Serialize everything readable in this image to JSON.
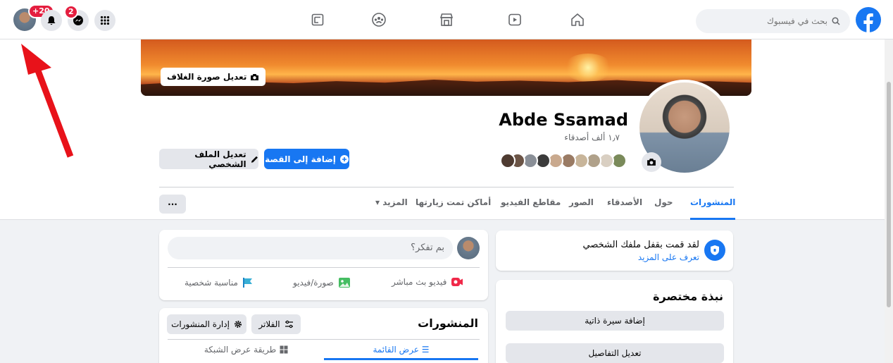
{
  "topbar": {
    "search_placeholder": "بحث في فيسبوك",
    "notifications_badge": "2",
    "profile_badge": "+20"
  },
  "cover": {
    "edit_label": "تعديل صورة الغلاف"
  },
  "profile": {
    "name": "Abde Ssamad",
    "friends": "١٫٧ ألف أصدقاء",
    "add_story_label": "إضافة إلى القصة",
    "edit_profile_label": "تعديل الملف الشخصي",
    "more_button": "···"
  },
  "tabs": [
    {
      "label": "المنشورات"
    },
    {
      "label": "حول"
    },
    {
      "label": "الأصدقاء"
    },
    {
      "label": "الصور"
    },
    {
      "label": "مقاطع الفيديو"
    },
    {
      "label": "أماكن تمت زيارتها"
    },
    {
      "label": "المزيد ▾"
    }
  ],
  "lock_notice": {
    "title": "لقد قمت بقفل ملفك الشخصي",
    "link": "تعرف على المزيد"
  },
  "intro": {
    "title": "نبذة مختصرة",
    "add_bio": "إضافة سيرة ذاتية",
    "edit_details": "تعديل التفاصيل"
  },
  "composer": {
    "placeholder": "بم تفكر؟",
    "live": "فيديو بث مباشر",
    "photo": "صورة/فيديو",
    "event": "مناسبة شخصية"
  },
  "posts": {
    "title": "المنشورات",
    "filters": "الفلاتر",
    "manage": "إدارة المنشورات",
    "list_view": "☰ عرض القائمة",
    "grid_view": "طريقة عرض الشبكة"
  },
  "colors": {
    "accent": "#1877f2",
    "badge": "#e41e3f",
    "arrow": "#e8121a"
  }
}
